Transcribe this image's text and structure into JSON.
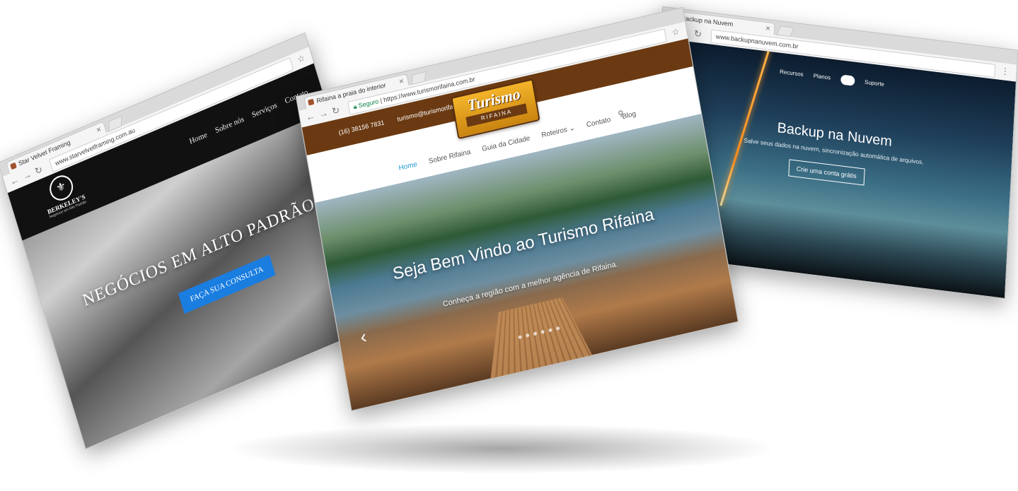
{
  "window_left": {
    "tab_title": "Star Velvet Framing",
    "address": "www.starvelvetframing.com.au",
    "brand_name": "BERKELEY'S",
    "brand_tagline": "Negócios em Alto Padrão",
    "menu": [
      "Home",
      "Sobre nós",
      "Serviços",
      "Contato"
    ],
    "hero_title": "NEGÓCIOS EM ALTO PADRÃO",
    "cta_label": "FAÇA SUA CONSULTA"
  },
  "window_center": {
    "tab_title": "Rifaina a praia do interior",
    "address_secure": "Seguro",
    "address": "https://www.turismorifaina.com.br",
    "phone": "(16) 38156 7831",
    "email": "turismo@turismorifaina.com.br",
    "brand_main": "Turismo",
    "brand_sub": "RIFAINA",
    "menu": [
      "Home",
      "Sobre Rifaina",
      "Guia da Cidade",
      "Roteiros ⌄",
      "Contato",
      "Blog"
    ],
    "hero_title": "Seja Bem Vindo ao Turismo Rifaina",
    "hero_sub": "Conheça a região com a melhor agência de Rifaina."
  },
  "window_right": {
    "tab_title": "Backup na Nuvem",
    "address": "www.backupnanuvem.com.br",
    "menu": [
      "Recursos",
      "Planos",
      "Suporte"
    ],
    "hero_title": "Backup na Nuvem",
    "hero_sub": "Salve seus dados na nuvem, sincronização automática de arquivos.",
    "cta_label": "Crie uma conta grátis"
  }
}
